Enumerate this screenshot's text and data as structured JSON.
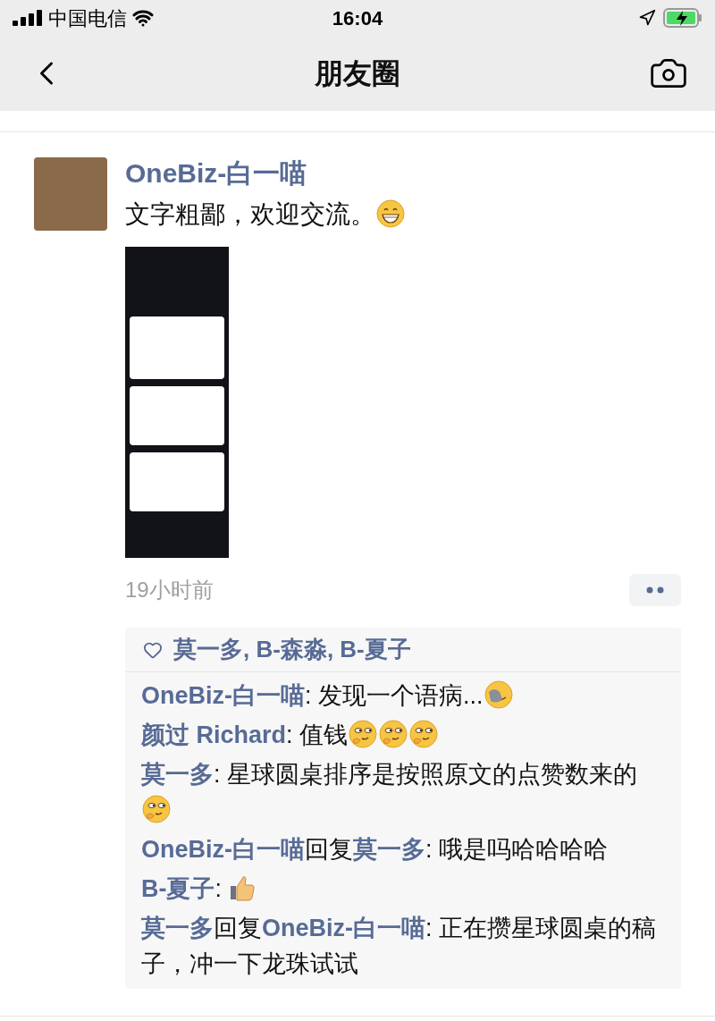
{
  "status_bar": {
    "carrier": "中国电信",
    "time": "16:04"
  },
  "nav": {
    "title": "朋友圈"
  },
  "post": {
    "author": "OneBiz-白一喵",
    "text": "文字粗鄙，欢迎交流。",
    "text_emojis": [
      {
        "kind": "grin"
      }
    ],
    "time": "19小时前",
    "likes": "莫一多, B-森淼, B-夏子",
    "comments": [
      {
        "author": "OneBiz-白一喵",
        "text": ": 发现一个语病...",
        "emojis": [
          {
            "kind": "facepalm"
          }
        ]
      },
      {
        "author": "颜过 Richard",
        "text": ": 值钱",
        "emojis": [
          {
            "kind": "smirk"
          },
          {
            "kind": "smirk"
          },
          {
            "kind": "smirk"
          }
        ]
      },
      {
        "author": "莫一多",
        "text": ": 星球圆桌排序是按照原文的点赞数来的",
        "emojis": [
          {
            "kind": "smirk"
          }
        ]
      },
      {
        "author": "OneBiz-白一喵",
        "reply_label": "回复",
        "reply_to": "莫一多",
        "text": ": 哦是吗哈哈哈哈"
      },
      {
        "author": "B-夏子",
        "text": ": ",
        "emojis": [
          {
            "kind": "thumbs_up"
          }
        ]
      },
      {
        "author": "莫一多",
        "reply_label": "回复",
        "reply_to": "OneBiz-白一喵",
        "text": ": 正在攒星球圆桌的稿子，冲一下龙珠试试"
      }
    ]
  }
}
